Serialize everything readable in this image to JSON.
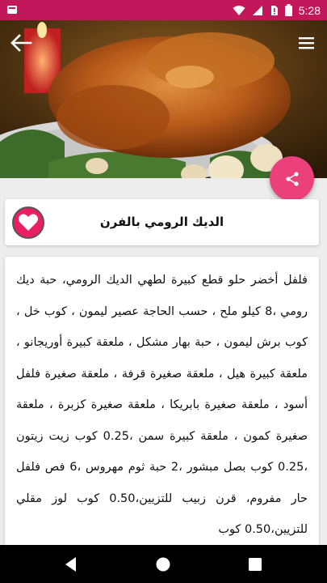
{
  "status_bar": {
    "time": "5:28",
    "icons": [
      "app-notification-icon",
      "wifi-icon",
      "signal-icon",
      "no-sim-icon",
      "battery-icon"
    ]
  },
  "header": {
    "back_icon": "arrow-back-icon",
    "menu_icon": "hamburger-menu-icon",
    "image_subject": "roast-turkey-photo"
  },
  "share_button": {
    "icon": "share-icon",
    "color": "#ec407a"
  },
  "recipe": {
    "title": "الديك الرومي بالفرن",
    "favorite_icon": "heart-icon",
    "ingredients": "فلفل أخضر حلو قطع كبيرة لطهي الديك الرومي، حبة ديك رومي ،8 كيلو ملح ، حسب الحاجة عصير ليمون ، كوب خل ، كوب برش ليمون ، حبة بهار مشكل ، ملعقة كبيرة أوريجانو ، ملعقة كبيرة هيل ، ملعقة صغيرة قرفة ، ملعقة صغيرة فلفل أسود ، ملعقة صغيرة بابريكا ، ملعقة صغيرة كزبرة ، ملعقة صغيرة كمون ، ملعقة كبيرة سمن ،0.25 كوب زيت زيتون ،0.25 كوب بصل مبشور ،2 حبة ثوم مهروس ،6 فص فلفل حار مفروم، قرن زبيب للتزيين،0.50 كوب لوز مقلي للتزيين،0.50 كوب"
  },
  "nav_bar": {
    "back_icon": "nav-back-icon",
    "home_icon": "nav-home-icon",
    "recents_icon": "nav-recents-icon"
  },
  "colors": {
    "status_bar": "#c2185b",
    "accent": "#e91e63",
    "background": "#ededed"
  }
}
